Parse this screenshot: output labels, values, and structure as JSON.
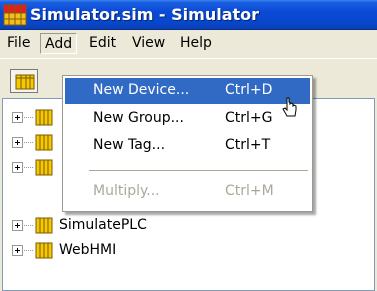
{
  "window": {
    "title": "Simulator.sim - Simulator",
    "app_icon": "simulator-grid-icon"
  },
  "menubar": {
    "items": [
      {
        "label": "File"
      },
      {
        "label": "Add"
      },
      {
        "label": "Edit"
      },
      {
        "label": "View"
      },
      {
        "label": "Help"
      }
    ],
    "open_menu": "Add"
  },
  "toolbar": {
    "buttons": [
      {
        "icon": "folder-grid-icon"
      }
    ]
  },
  "add_menu": {
    "items": [
      {
        "label": "New Device...",
        "shortcut": "Ctrl+D",
        "state": "highlighted"
      },
      {
        "label": "New Group...",
        "shortcut": "Ctrl+G",
        "state": "normal"
      },
      {
        "label": "New Tag...",
        "shortcut": "Ctrl+T",
        "state": "normal"
      },
      {
        "label": "Multiply...",
        "shortcut": "Ctrl+M",
        "state": "disabled"
      }
    ]
  },
  "tree": {
    "items": [
      {
        "label": ""
      },
      {
        "label": ""
      },
      {
        "label": ""
      },
      {
        "label": "SimulatePLC"
      },
      {
        "label": "WebHMI"
      }
    ]
  },
  "colors": {
    "title_bar": "#0a4ad8",
    "menu_highlight": "#316ac5",
    "folder_yellow": "#f5c800",
    "disabled_text": "#aca899"
  }
}
